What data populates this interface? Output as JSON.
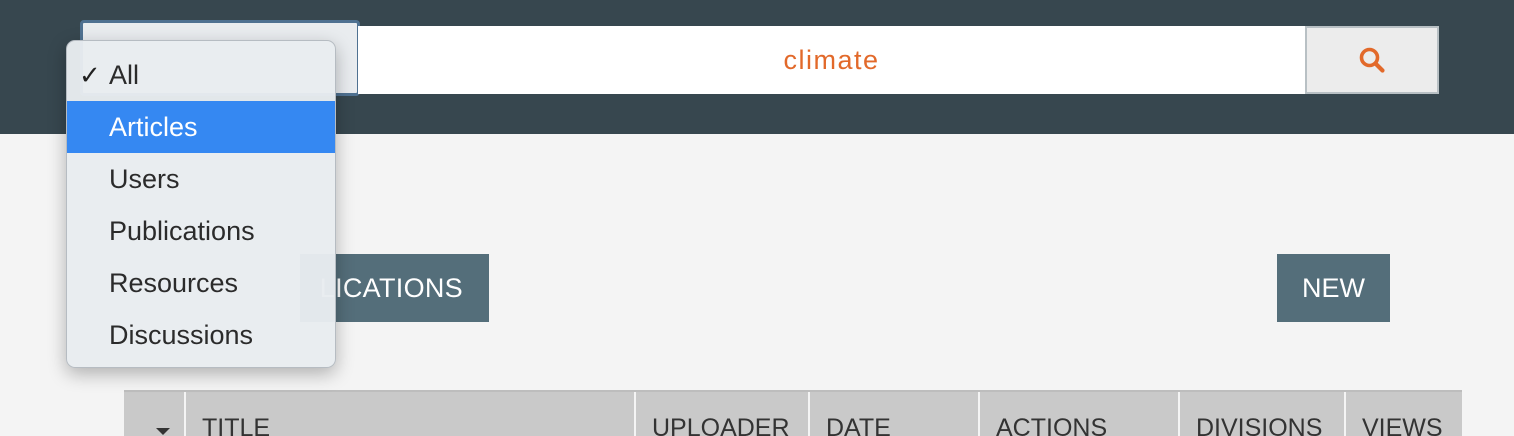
{
  "search": {
    "category_options": [
      {
        "label": "All",
        "checked": true
      },
      {
        "label": "Articles",
        "highlighted": true
      },
      {
        "label": "Users"
      },
      {
        "label": "Publications"
      },
      {
        "label": "Resources"
      },
      {
        "label": "Discussions"
      }
    ],
    "query": "climate",
    "button_icon": "search-icon"
  },
  "toolbar": {
    "publications_label": "LICATIONS",
    "new_label": "NEW"
  },
  "table": {
    "sort_icon": "caret-down-icon",
    "columns": [
      "TITLE",
      "UPLOADER",
      "DATE",
      "ACTIONS",
      "DIVISIONS",
      "VIEWS"
    ]
  },
  "colors": {
    "header_bg": "#37474f",
    "accent": "#e2692a",
    "button_bg": "#546e7a",
    "menu_highlight": "#3588f2"
  }
}
